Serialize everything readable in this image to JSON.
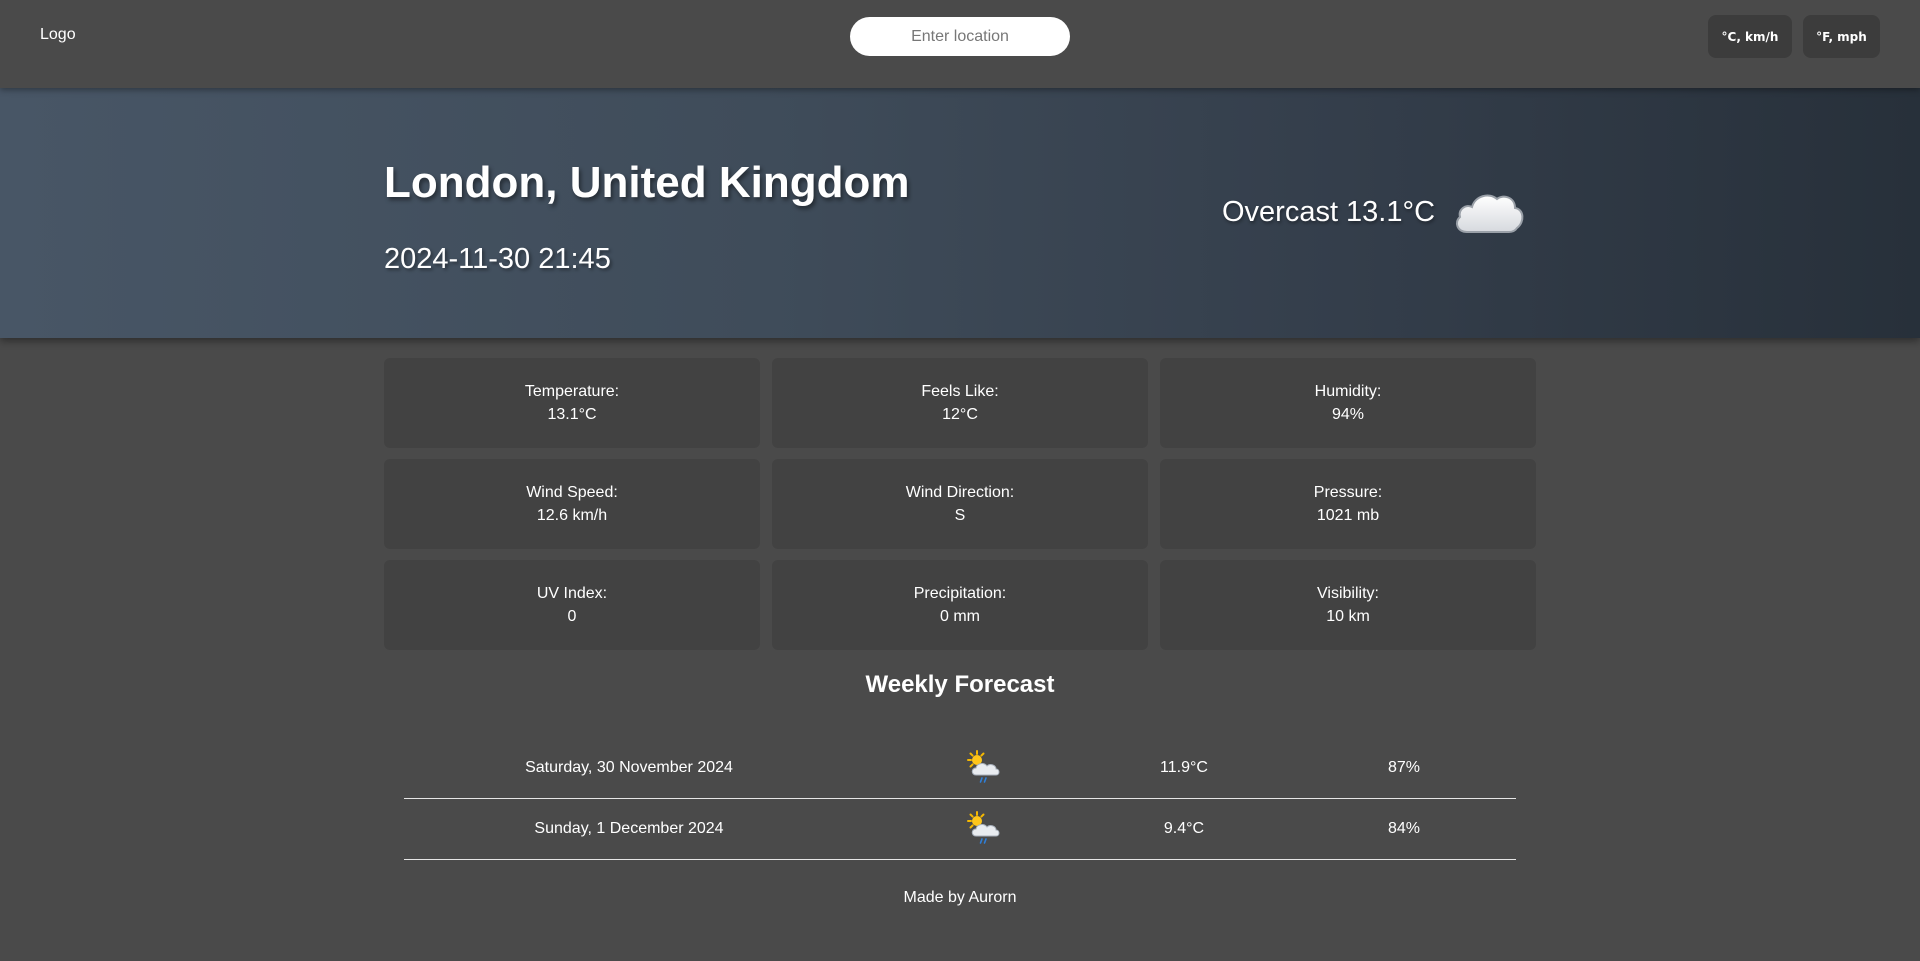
{
  "header": {
    "logo": "Logo",
    "search_placeholder": "Enter location",
    "unit_metric": "°C, km/h",
    "unit_imperial": "°F, mph"
  },
  "current": {
    "location": "London, United Kingdom",
    "datetime": "2024-11-30 21:45",
    "condition": "Overcast",
    "temperature": "13.1°C",
    "icon": "cloud-icon"
  },
  "stats": [
    {
      "label": "Temperature:",
      "value": "13.1°C"
    },
    {
      "label": "Feels Like:",
      "value": "12°C"
    },
    {
      "label": "Humidity:",
      "value": "94%"
    },
    {
      "label": "Wind Speed:",
      "value": "12.6 km/h"
    },
    {
      "label": "Wind Direction:",
      "value": "S"
    },
    {
      "label": "Pressure:",
      "value": "1021 mb"
    },
    {
      "label": "UV Index:",
      "value": "0"
    },
    {
      "label": "Precipitation:",
      "value": "0 mm"
    },
    {
      "label": "Visibility:",
      "value": "10 km"
    }
  ],
  "forecast": {
    "title": "Weekly Forecast",
    "days": [
      {
        "date": "Saturday, 30 November 2024",
        "icon": "sun-cloud-rain-icon",
        "temp": "11.9°C",
        "humidity": "87%"
      },
      {
        "date": "Sunday, 1 December 2024",
        "icon": "sun-cloud-rain-icon",
        "temp": "9.4°C",
        "humidity": "84%"
      }
    ]
  },
  "footer": "Made by Aurorn",
  "colors": {
    "background": "#4a4a4a",
    "card": "#424242",
    "button": "#3c3c3c",
    "hero_left": "#485666",
    "hero_right": "#27303a"
  }
}
